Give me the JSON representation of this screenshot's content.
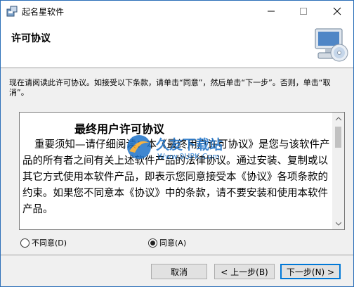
{
  "window": {
    "title": "起名星软件",
    "minimize_glyph": "—",
    "maximize_glyph": "☐",
    "close_glyph": "✕"
  },
  "header": {
    "title": "许可协议",
    "icon": "computer-cd-icon"
  },
  "instruction": "现在请阅读此许可协议。如接受以下条款，请单击“同意”，然后单击“下一步”。否则，单击“取消”。",
  "license": {
    "heading": "最终用户许可协议",
    "body": "重要须知—请仔细阅读：本《最终用户许可协议》是您与该软件产品的所有者之间有关上述软件产品的法律协议。通过安装、复制或以其它方式使用本软件产品，即表示您同意接受本《协议》各项条款的约束。如果您不同意本《协议》中的条款，请不要安装和使用本软件产品。"
  },
  "watermark": {
    "brand": "久友下载站",
    "url": "Www.9UPK.Com"
  },
  "options": {
    "disagree_label": "不同意(D)",
    "agree_label": "同意(A)",
    "selected": "agree"
  },
  "buttons": {
    "cancel": "取消",
    "back": "< 上一步(B)",
    "next": "下一步(N) >"
  },
  "colors": {
    "window_border": "#2b6fb8",
    "default_button_border": "#0078d7",
    "watermark_blue": "#1e73c8",
    "watermark_orange": "#f5a623"
  }
}
